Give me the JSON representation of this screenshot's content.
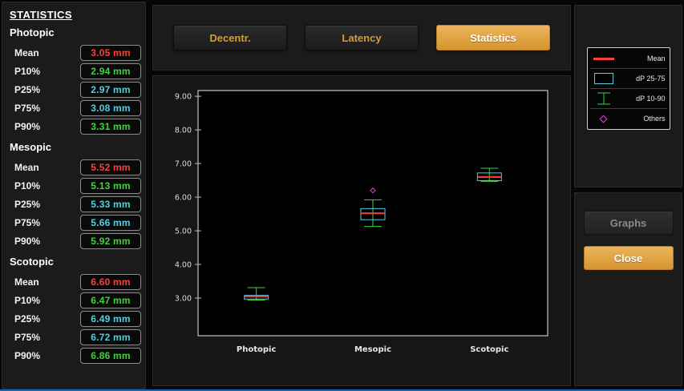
{
  "stats_panel": {
    "title": "STATISTICS",
    "sections": [
      {
        "name": "Photopic",
        "rows": [
          {
            "label": "Mean",
            "value": "3.05 mm"
          },
          {
            "label": "P10%",
            "value": "2.94 mm"
          },
          {
            "label": "P25%",
            "value": "2.97 mm"
          },
          {
            "label": "P75%",
            "value": "3.08 mm"
          },
          {
            "label": "P90%",
            "value": "3.31 mm"
          }
        ]
      },
      {
        "name": "Mesopic",
        "rows": [
          {
            "label": "Mean",
            "value": "5.52 mm"
          },
          {
            "label": "P10%",
            "value": "5.13 mm"
          },
          {
            "label": "P25%",
            "value": "5.33 mm"
          },
          {
            "label": "P75%",
            "value": "5.66 mm"
          },
          {
            "label": "P90%",
            "value": "5.92 mm"
          }
        ]
      },
      {
        "name": "Scotopic",
        "rows": [
          {
            "label": "Mean",
            "value": "6.60 mm"
          },
          {
            "label": "P10%",
            "value": "6.47 mm"
          },
          {
            "label": "P25%",
            "value": "6.49 mm"
          },
          {
            "label": "P75%",
            "value": "6.72 mm"
          },
          {
            "label": "P90%",
            "value": "6.86 mm"
          }
        ]
      }
    ]
  },
  "tabs": [
    {
      "label": "Decentr.",
      "active": false
    },
    {
      "label": "Latency",
      "active": false
    },
    {
      "label": "Statistics",
      "active": true
    }
  ],
  "legend": {
    "items": [
      {
        "label": "Mean",
        "symbol": "mean-line"
      },
      {
        "label": "dP 25-75",
        "symbol": "iqr-box"
      },
      {
        "label": "dP 10-90",
        "symbol": "whisker"
      },
      {
        "label": "Others",
        "symbol": "outlier-diamond"
      }
    ]
  },
  "actions": {
    "graphs": "Graphs",
    "close": "Close"
  },
  "colors": {
    "mean": "#f8423a",
    "p10_p90": "#3fd33f",
    "p25_p75": "#4fd0e4",
    "outlier": "#d24fd2",
    "accent_gold": "#dfa440",
    "tab_text": "#d89a38"
  },
  "chart_data": {
    "type": "boxplot",
    "title": "",
    "categories": [
      "Photopic",
      "Mesopic",
      "Scotopic"
    ],
    "series": [
      {
        "name": "Photopic",
        "p10": 2.94,
        "p25": 2.97,
        "mean": 3.05,
        "p75": 3.08,
        "p90": 3.31,
        "outliers": []
      },
      {
        "name": "Mesopic",
        "p10": 5.13,
        "p25": 5.33,
        "mean": 5.52,
        "p75": 5.66,
        "p90": 5.92,
        "outliers": [
          6.2
        ]
      },
      {
        "name": "Scotopic",
        "p10": 6.47,
        "p25": 6.49,
        "mean": 6.6,
        "p75": 6.72,
        "p90": 6.86,
        "outliers": []
      }
    ],
    "y_ticks": [
      9,
      8,
      7,
      6,
      5,
      4,
      3
    ],
    "y_tick_labels": [
      "9.00",
      "8.00",
      "7.00",
      "6.00",
      "5.00",
      "4.00",
      "3.00"
    ],
    "ylim": [
      1.88,
      9.17
    ],
    "unit": "mm",
    "grid": false,
    "legend_position": "top-right-panel"
  }
}
